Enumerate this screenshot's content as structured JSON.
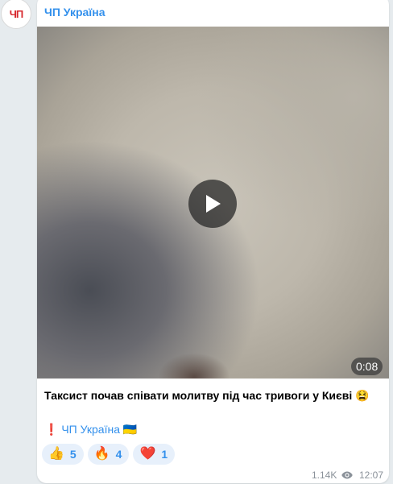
{
  "channel": {
    "name": "ЧП Україна",
    "avatar_text": "ЧП"
  },
  "post": {
    "video_duration": "0:08",
    "caption": "Таксист почав співати молитву під час тривоги у Києві 😫",
    "signature_mark": "❗",
    "signature_name": "ЧП Україна",
    "signature_flag": "🇺🇦",
    "views": "1.14K",
    "time": "12:07"
  },
  "reactions": [
    {
      "emoji": "👍",
      "count": "5"
    },
    {
      "emoji": "🔥",
      "count": "4"
    },
    {
      "emoji": "❤️",
      "count": "1"
    }
  ],
  "colors": {
    "accent": "#3390ec",
    "background": "#e6ebee",
    "avatar_text": "#d7262c"
  }
}
